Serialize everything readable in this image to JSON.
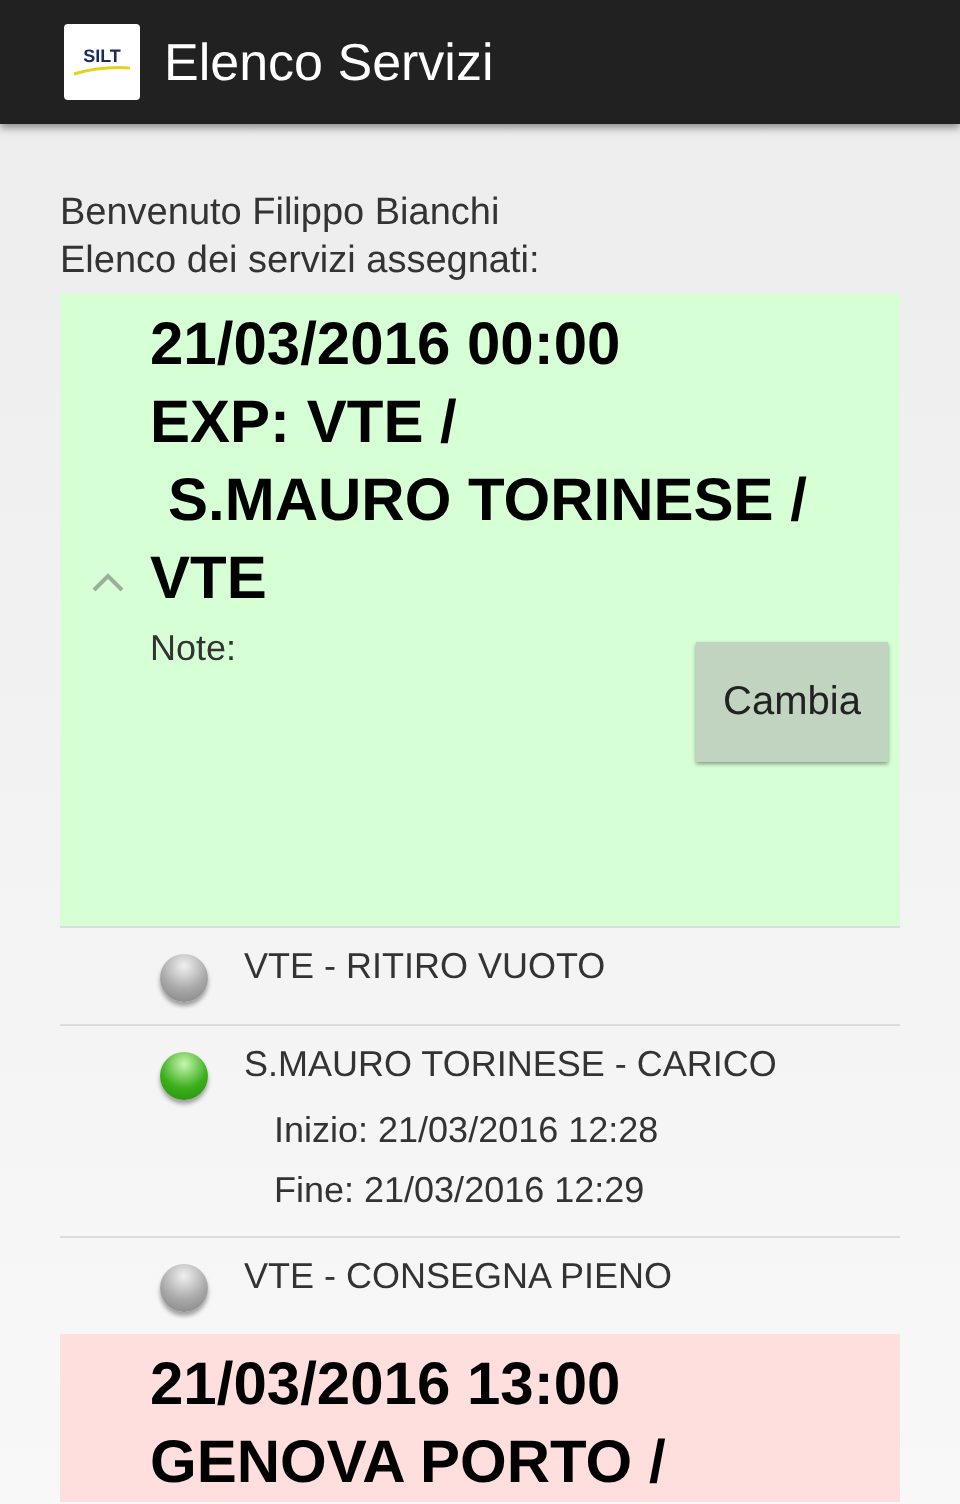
{
  "app_bar": {
    "logo_text": "SILT",
    "title": "Elenco Servizi"
  },
  "welcome": "Benvenuto Filippo Bianchi",
  "list_label": "Elenco dei servizi assegnati:",
  "services": [
    {
      "color": "#d6ffd6",
      "expanded": true,
      "title_lines": [
        "21/03/2016 00:00",
        "EXP: VTE /",
        "S.MAURO TORINESE /",
        "VTE"
      ],
      "note_label": "Note:",
      "button": "Cambia",
      "steps": [
        {
          "label": "VTE - RITIRO VUOTO",
          "done": false
        },
        {
          "label": "S.MAURO TORINESE - CARICO",
          "done": true,
          "details": [
            "Inizio: 21/03/2016 12:28",
            "Fine: 21/03/2016 12:29"
          ]
        },
        {
          "label": "VTE - CONSEGNA PIENO",
          "done": false
        }
      ]
    },
    {
      "color": "#ffdede",
      "title_lines": [
        "21/03/2016 13:00",
        "GENOVA PORTO /"
      ]
    }
  ]
}
